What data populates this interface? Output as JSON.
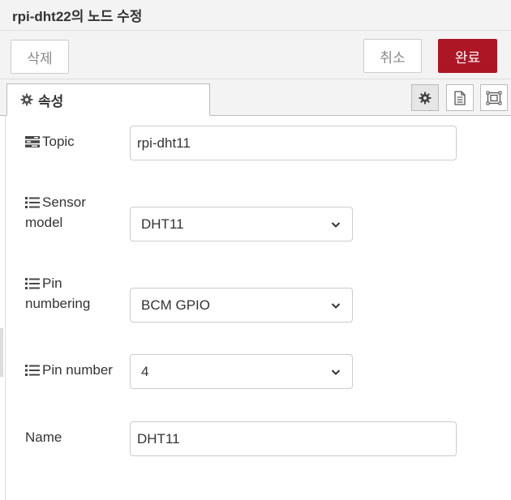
{
  "dialog": {
    "title": "rpi-dht22의 노드 수정"
  },
  "toolbar": {
    "delete_label": "삭제",
    "cancel_label": "취소",
    "done_label": "완료",
    "done_color": "#ad1625"
  },
  "tabs": {
    "properties_label": "속성",
    "icons": [
      "gear-icon",
      "description-icon",
      "appearance-icon"
    ]
  },
  "form": {
    "topic": {
      "label": "Topic",
      "value": "rpi-dht11"
    },
    "sensor_model": {
      "label_line1": "Sensor",
      "label_line2": "model",
      "value": "DHT11"
    },
    "pin_numbering": {
      "label_line1": "Pin",
      "label_line2": "numbering",
      "value": "BCM GPIO"
    },
    "pin_number": {
      "label": "Pin number",
      "value": "4"
    },
    "name": {
      "label": "Name",
      "value": "DHT11"
    }
  }
}
